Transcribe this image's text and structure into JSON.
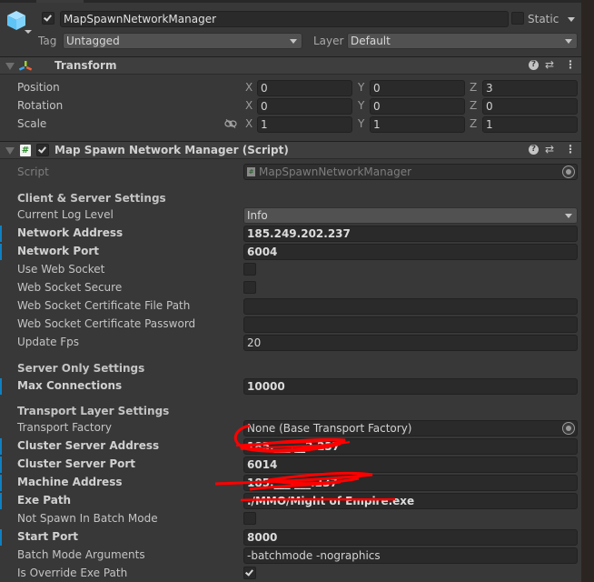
{
  "gameobject": {
    "active": true,
    "name": "MapSpawnNetworkManager",
    "static_label": "Static",
    "static_checked": false,
    "tag_label": "Tag",
    "tag_value": "Untagged",
    "layer_label": "Layer",
    "layer_value": "Default"
  },
  "transform": {
    "title": "Transform",
    "rows": [
      {
        "label": "Position",
        "x": "0",
        "y": "0",
        "z": "3"
      },
      {
        "label": "Rotation",
        "x": "0",
        "y": "0",
        "z": "0"
      },
      {
        "label": "Scale",
        "x": "1",
        "y": "1",
        "z": "1"
      }
    ],
    "axis_labels": [
      "X",
      "Y",
      "Z"
    ]
  },
  "script_component": {
    "title": "Map Spawn Network Manager (Script)",
    "enabled": true,
    "script_label": "Script",
    "script_value": "MapSpawnNetworkManager",
    "sections": {
      "client_server": "Client & Server Settings",
      "server_only": "Server Only Settings",
      "transport": "Transport Layer Settings"
    },
    "fields": {
      "log_level": {
        "label": "Current Log Level",
        "value": "Info"
      },
      "network_address": {
        "label": "Network Address",
        "value": "185.249.202.237"
      },
      "network_port": {
        "label": "Network Port",
        "value": "6004"
      },
      "use_web_socket": {
        "label": "Use Web Socket",
        "checked": false
      },
      "web_socket_secure": {
        "label": "Web Socket Secure",
        "checked": false
      },
      "cert_file_path": {
        "label": "Web Socket Certificate File Path",
        "value": ""
      },
      "cert_password": {
        "label": "Web Socket Certificate Password",
        "value": ""
      },
      "update_fps": {
        "label": "Update Fps",
        "value": "20"
      },
      "max_connections": {
        "label": "Max Connections",
        "value": "10000"
      },
      "transport_factory": {
        "label": "Transport Factory",
        "value": "None (Base Transport Factory)"
      },
      "cluster_server_address": {
        "label": "Cluster Server Address",
        "value": "185.___.__2.237"
      },
      "cluster_server_port": {
        "label": "Cluster Server Port",
        "value": "6014"
      },
      "machine_address": {
        "label": "Machine Address",
        "value": "185.___.___.237"
      },
      "exe_path": {
        "label": "Exe Path",
        "value": "./MMO/Might of Empire.exe"
      },
      "not_spawn_in_batch_mode": {
        "label": "Not Spawn In Batch Mode",
        "checked": false
      },
      "start_port": {
        "label": "Start Port",
        "value": "8000"
      },
      "batch_mode_arguments": {
        "label": "Batch Mode Arguments",
        "value": "-batchmode -nographics"
      },
      "is_override_exe_path": {
        "label": "Is Override Exe Path",
        "checked": true
      }
    }
  },
  "icons": {
    "help": "?",
    "presets": "⇄",
    "menu": "⋮",
    "script_hash": "#"
  },
  "colors": {
    "override_bar": "#0f81c2",
    "redaction": "#ff0000"
  }
}
